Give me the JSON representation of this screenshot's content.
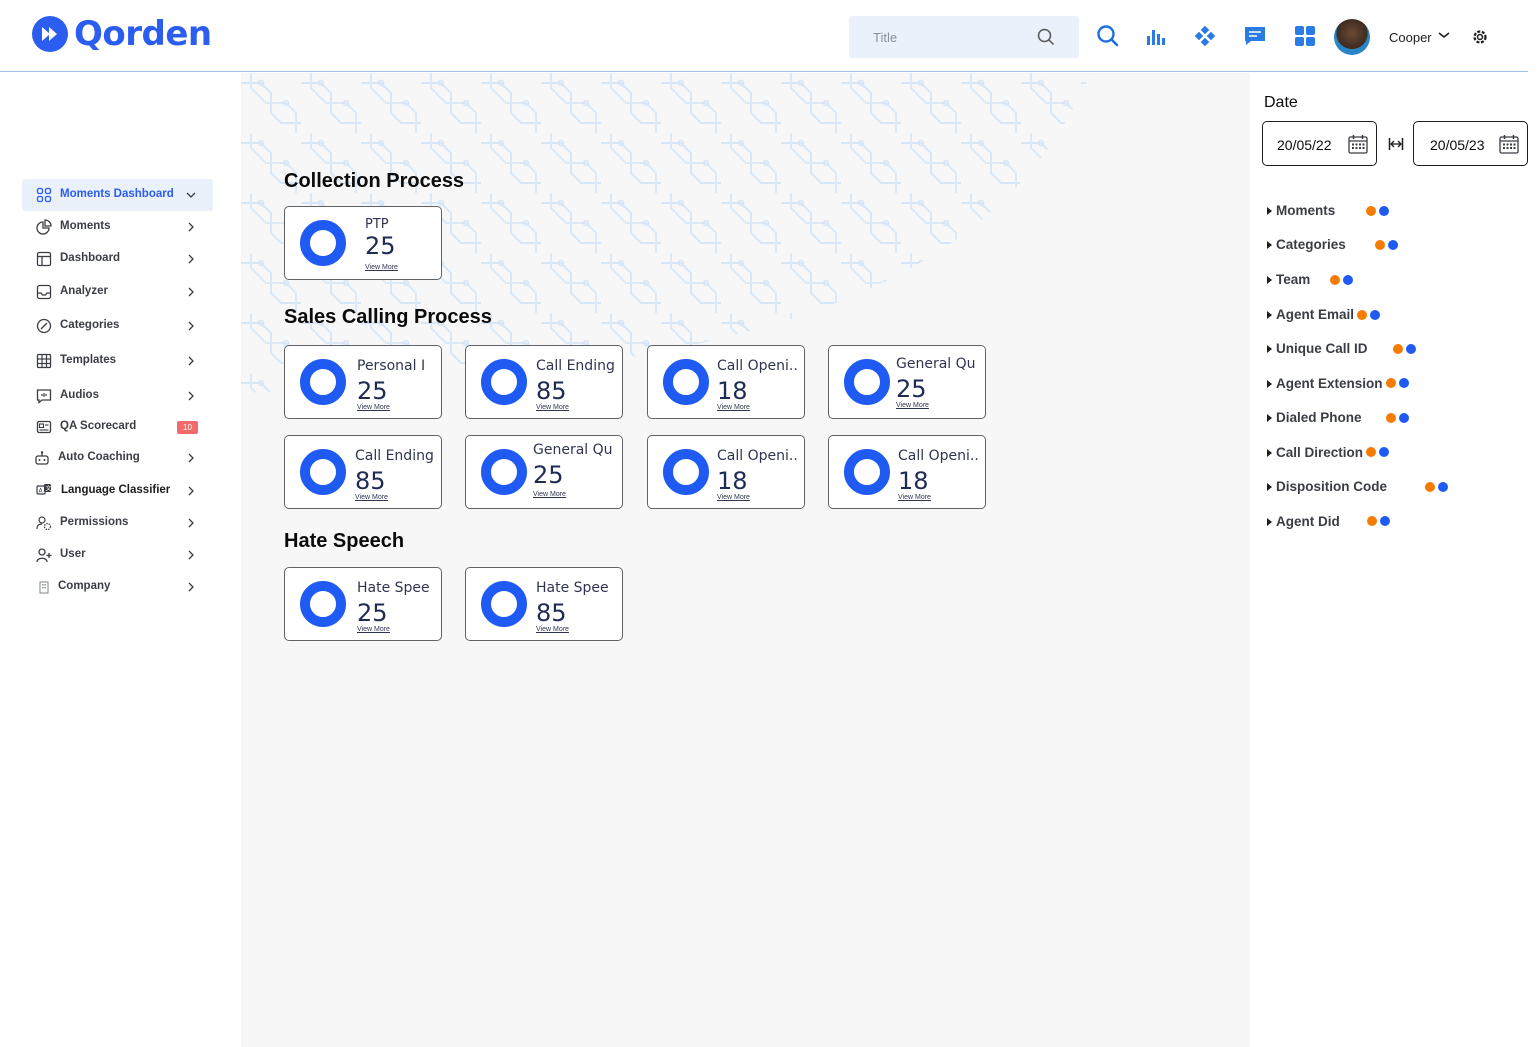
{
  "app": {
    "name": "Qorden",
    "brand_color": "#2a5df0"
  },
  "header": {
    "search_placeholder": "Title",
    "icons": [
      "search-icon",
      "bar-chart-icon",
      "diamond-grid-icon",
      "chat-icon",
      "apps-grid-icon"
    ],
    "user_name": "Cooper"
  },
  "sidebar": {
    "items": [
      {
        "label": "Moments Dashboard",
        "icon": "grid-icon",
        "active": true
      },
      {
        "label": "Moments",
        "icon": "pie-chart-icon"
      },
      {
        "label": "Dashboard",
        "icon": "layout-icon"
      },
      {
        "label": "Analyzer",
        "icon": "inbox-icon"
      },
      {
        "label": "Categories",
        "icon": "compass-icon"
      },
      {
        "label": "Templates",
        "icon": "table-icon"
      },
      {
        "label": "Audios",
        "icon": "audio-icon"
      },
      {
        "label": "QA Scorecard",
        "icon": "scorecard-icon",
        "badge": "10"
      },
      {
        "label": "Auto Coaching",
        "icon": "robot-icon"
      },
      {
        "label": "Language Classifier",
        "icon": "translate-icon"
      },
      {
        "label": "Permissions",
        "icon": "permissions-icon"
      },
      {
        "label": "User",
        "icon": "user-add-icon"
      },
      {
        "label": "Company",
        "icon": "building-icon"
      }
    ]
  },
  "main": {
    "sections": [
      {
        "title": "Collection Process",
        "cards": [
          {
            "label": "PTP",
            "value": "25"
          }
        ]
      },
      {
        "title": "Sales Calling Process",
        "cards": [
          {
            "label": "Personal I",
            "value": "25"
          },
          {
            "label": "Call Ending",
            "value": "85"
          },
          {
            "label": "Call Openi..",
            "value": "18"
          },
          {
            "label": "General Qu",
            "value": "25"
          },
          {
            "label": "Call Ending",
            "value": "85"
          },
          {
            "label": "General Qu",
            "value": "25"
          },
          {
            "label": "Call Openi..",
            "value": "18"
          },
          {
            "label": "Call Openi..",
            "value": "18"
          }
        ]
      },
      {
        "title": "Hate Speech",
        "cards": [
          {
            "label": "Hate Spee",
            "value": "25"
          },
          {
            "label": "Hate Spee",
            "value": "85"
          }
        ]
      }
    ],
    "view_more_label": "View More",
    "donut_color": "#1f5af2"
  },
  "right_panel": {
    "date_title": "Date",
    "date_from": "20/05/22",
    "date_to": "20/05/23",
    "filters": [
      "Moments",
      "Categories",
      "Team",
      "Agent Email",
      "Unique Call ID",
      "Agent Extension",
      "Dialed Phone",
      "Call Direction",
      "Disposition Code",
      "Agent Did"
    ],
    "dot_colors": [
      "#f57c00",
      "#1f5af2"
    ]
  }
}
